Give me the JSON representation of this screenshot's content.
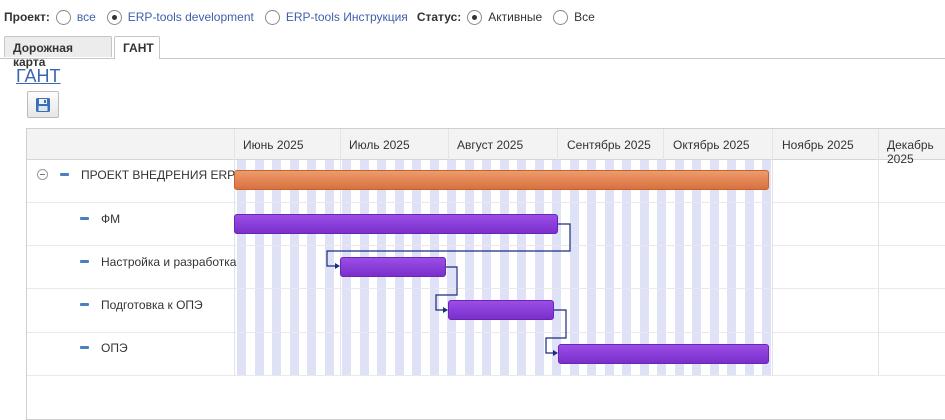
{
  "filters": {
    "project_label": "Проект:",
    "project_options": [
      {
        "label": "все",
        "selected": false
      },
      {
        "label": "ERP-tools development",
        "selected": true
      },
      {
        "label": "ERP-tools Инструкция",
        "selected": false
      }
    ],
    "status_label": "Статус:",
    "status_options": [
      {
        "label": "Активные",
        "selected": true
      },
      {
        "label": "Все",
        "selected": false
      }
    ]
  },
  "tabs": [
    {
      "label": "Дорожная карта",
      "active": false
    },
    {
      "label": "ГАНТ",
      "active": true
    }
  ],
  "page_title": "ГАНТ",
  "toolbar": {
    "save_icon": "floppy-disk-icon"
  },
  "gantt": {
    "months": [
      "Июнь 2025",
      "Июль 2025",
      "Август 2025",
      "Сентябрь 2025",
      "Октябрь 2025",
      "Ноябрь 2025",
      "Декабрь 2025"
    ],
    "tasks": [
      {
        "label": "ПРОЕКТ ВНЕДРЕНИЯ ERP",
        "color": "#e0814e",
        "type": "project"
      },
      {
        "label": "ФМ",
        "color": "#8a3fdc",
        "type": "task"
      },
      {
        "label": "Настройка и разработка",
        "color": "#8a3fdc",
        "type": "task"
      },
      {
        "label": "Подготовка к ОПЭ",
        "color": "#8a3fdc",
        "type": "task"
      },
      {
        "label": "ОПЭ",
        "color": "#8a3fdc",
        "type": "task"
      }
    ]
  }
}
